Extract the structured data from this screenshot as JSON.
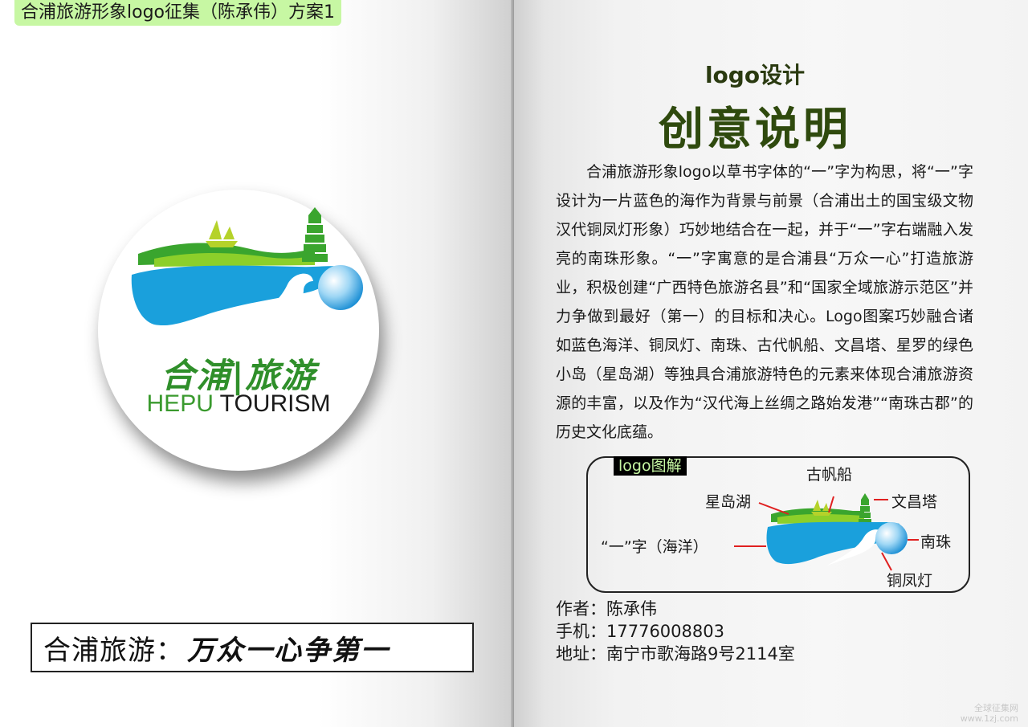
{
  "header": {
    "title": "合浦旅游形象logo征集（陈承伟）方案1"
  },
  "logo": {
    "cn_text": "合浦|旅游",
    "en_hepu": "HEPU",
    "en_tourism": "TOURISM"
  },
  "slogan": {
    "prefix": "合浦旅游：",
    "motto": "万众一心争第一"
  },
  "description": {
    "subtitle": "logo设计",
    "title": "创意说明",
    "body": "合浦旅游形象logo以草书字体的“一”字为构思，将“一”字设计为一片蓝色的海作为背景与前景（合浦出土的国宝级文物汉代铜凤灯形象）巧妙地结合在一起，并于“一”字右端融入发亮的南珠形象。“一”字寓意的是合浦县“万众一心”打造旅游业，积极创建“广西特色旅游名县”和“国家全域旅游示范区”并力争做到最好（第一）的目标和决心。Logo图案巧妙融合诸如蓝色海洋、铜凤灯、南珠、古代帆船、文昌塔、星罗的绿色小岛（星岛湖）等独具合浦旅游特色的元素来体现合浦旅游资源的丰富，以及作为“汉代海上丝绸之路始发港”“南珠古郡”的历史文化底蕴。"
  },
  "diagram": {
    "label": "logo图解",
    "parts": {
      "ancient_sail_boat": "古帆船",
      "star_island_lake": "星岛湖",
      "wenchang_pagoda": "文昌塔",
      "character_yi_sea": "“一”字（海洋）",
      "south_pearl": "南珠",
      "bronze_phoenix_lamp": "铜凤灯"
    }
  },
  "contact": {
    "author": "作者：陈承伟",
    "phone": "手机：17776008803",
    "address": "地址：南宁市歌海路9号2114室"
  },
  "watermark": {
    "line1": "全球征集网",
    "line2": "www.1zj.com"
  },
  "colors": {
    "header_bg": "#c7f7a3",
    "sea_blue": "#1aa0dc",
    "island_green": "#3aa52e",
    "title_green": "#2f4a0e",
    "pointer_red": "#e02020"
  }
}
